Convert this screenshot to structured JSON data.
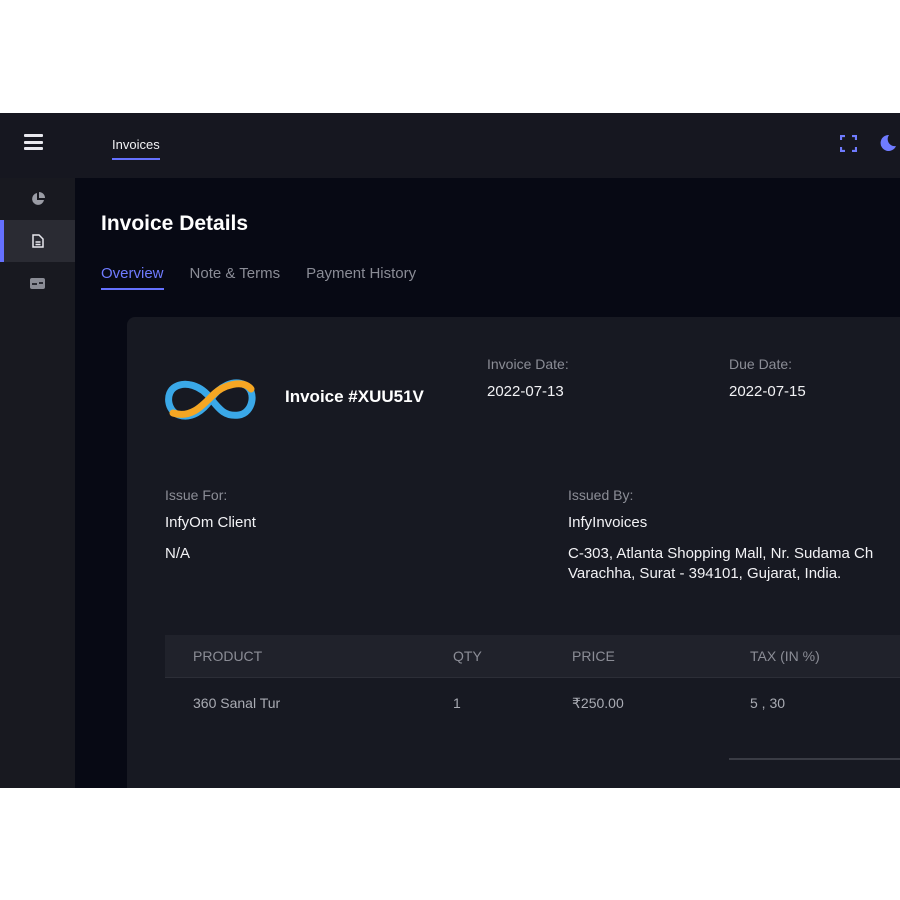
{
  "header": {
    "tab": "Invoices",
    "icons": [
      "menu-icon",
      "fullscreen-icon",
      "moon-icon"
    ],
    "accent": "#6571ff"
  },
  "sidebar": {
    "items": [
      {
        "icon": "pie-chart-icon"
      },
      {
        "icon": "invoice-file-icon",
        "active": true
      },
      {
        "icon": "card-icon"
      }
    ]
  },
  "page": {
    "title": "Invoice Details",
    "tabs": [
      "Overview",
      "Note & Terms",
      "Payment History"
    ],
    "active_tab": "Overview"
  },
  "invoice": {
    "number": "Invoice #XUU51V",
    "invoice_date_label": "Invoice Date:",
    "invoice_date": "2022-07-13",
    "due_date_label": "Due Date:",
    "due_date": "2022-07-15",
    "issue_for_label": "Issue For:",
    "issue_for_name": "InfyOm Client",
    "issue_for_address": "N/A",
    "issued_by_label": "Issued By:",
    "issued_by_name": "InfyInvoices",
    "issued_by_address_1": "C-303, Atlanta Shopping Mall, Nr. Sudama Ch",
    "issued_by_address_2": "Varachha, Surat - 394101, Gujarat, India."
  },
  "table": {
    "headers": [
      "PRODUCT",
      "QTY",
      "PRICE",
      "TAX (IN %)"
    ],
    "rows": [
      [
        "360 Sanal Tur",
        "1",
        "₹250.00",
        "5 , 30"
      ]
    ]
  }
}
